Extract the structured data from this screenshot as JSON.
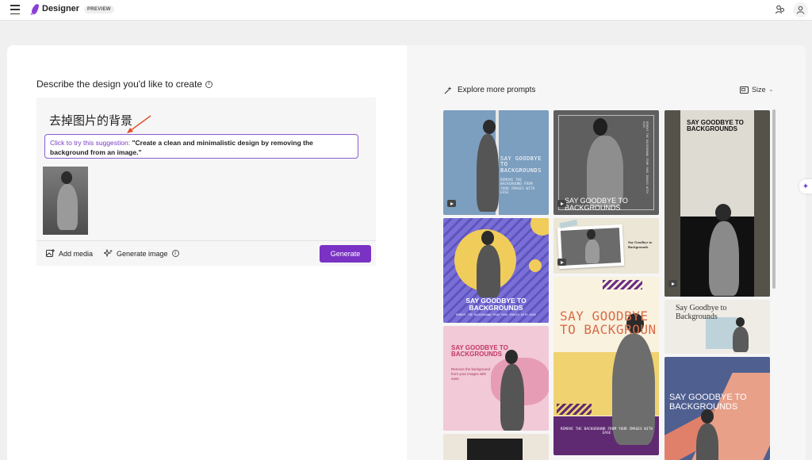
{
  "app": {
    "brand": "Designer",
    "badge": "PREVIEW",
    "accent_color": "#7a32c4"
  },
  "prompt_panel": {
    "title": "Describe the design you'd like to create",
    "input_text": "去掉图片的背景",
    "suggestion_lead": "Click to try this suggestion: ",
    "suggestion_text": "\"Create a clean and minimalistic design by removing the background from an image.\"",
    "add_media_label": "Add media",
    "generate_image_label": "Generate image",
    "generate_button": "Generate"
  },
  "gallery_panel": {
    "explore_label": "Explore more prompts",
    "size_label": "Size",
    "tiles": [
      {
        "headline": "SAY GOODBYE TO BACKGROUNDS",
        "subline": "REMOVE THE BACKGROUND FROM YOUR IMAGES WITH EASE"
      },
      {
        "headline": "SAY GOODBYE TO BACKGROUNDS",
        "subline": "REMOVE THE BACKGROUND FROM YOUR IMAGES WITH EASE"
      },
      {
        "headline": "SAY GOODBYE TO BACKGROUNDS"
      },
      {
        "headline": "SAY GOODBYE TO BACKGROUNDS",
        "subline": "REMOVE THE BACKGROUND FROM YOUR IMAGES WITH EASE"
      },
      {
        "headline": "Say Goodbye to Backgrounds"
      },
      {
        "headline": "SAY GOODBYE TO BACKGROUNDS",
        "subline": "Remove the background from your images with ease"
      },
      {
        "headline": "SAY GOODBYE TO BACKGROUN",
        "subline": "REMOVE THE BACKGROUND FROM YOUR IMAGES WITH EASE"
      },
      {
        "headline": "Say Goodbye to Backgrounds"
      },
      {
        "headline": "SAY GOODBYE TO BACKGROUNDS"
      }
    ]
  }
}
